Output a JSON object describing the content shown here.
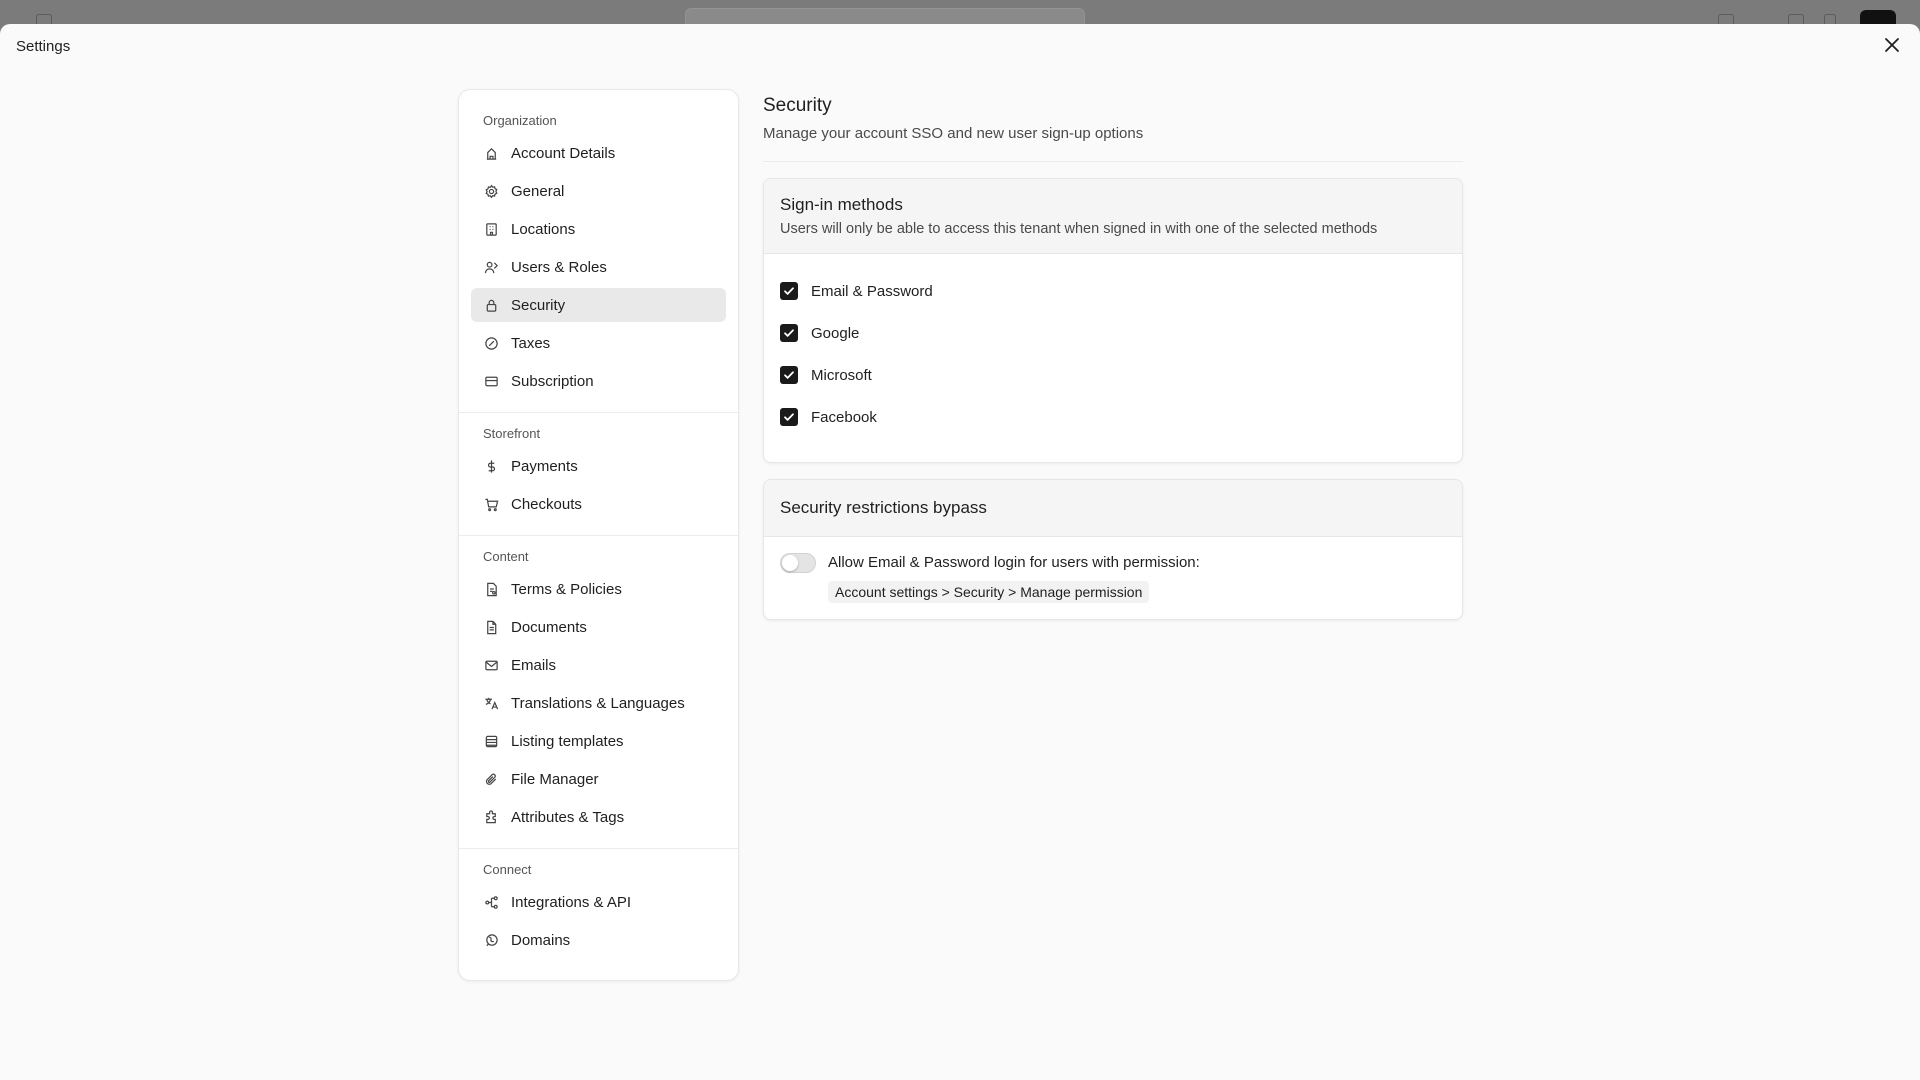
{
  "modal": {
    "title": "Settings"
  },
  "sidebar": {
    "sections": [
      {
        "title": "Organization",
        "items": [
          {
            "label": "Account Details",
            "icon": "building-icon"
          },
          {
            "label": "General",
            "icon": "gear-icon"
          },
          {
            "label": "Locations",
            "icon": "office-building-icon"
          },
          {
            "label": "Users & Roles",
            "icon": "users-icon"
          },
          {
            "label": "Security",
            "icon": "lock-icon",
            "active": true
          },
          {
            "label": "Taxes",
            "icon": "percent-badge-icon"
          },
          {
            "label": "Subscription",
            "icon": "credit-card-icon"
          }
        ]
      },
      {
        "title": "Storefront",
        "items": [
          {
            "label": "Payments",
            "icon": "dollar-icon"
          },
          {
            "label": "Checkouts",
            "icon": "cart-icon"
          }
        ]
      },
      {
        "title": "Content",
        "items": [
          {
            "label": "Terms & Policies",
            "icon": "policy-document-icon"
          },
          {
            "label": "Documents",
            "icon": "document-icon"
          },
          {
            "label": "Emails",
            "icon": "mail-icon"
          },
          {
            "label": "Translations & Languages",
            "icon": "translate-icon"
          },
          {
            "label": "Listing templates",
            "icon": "template-list-icon"
          },
          {
            "label": "File Manager",
            "icon": "paperclip-icon"
          },
          {
            "label": "Attributes & Tags",
            "icon": "puzzle-icon"
          }
        ]
      },
      {
        "title": "Connect",
        "items": [
          {
            "label": "Integrations & API",
            "icon": "integration-icon"
          },
          {
            "label": "Domains",
            "icon": "globe-icon"
          }
        ]
      }
    ]
  },
  "main": {
    "title": "Security",
    "subtitle": "Manage your account SSO and new user sign-up options",
    "signin": {
      "title": "Sign-in methods",
      "description": "Users will only be able to access this tenant when signed in with one of the selected methods",
      "methods": [
        {
          "label": "Email & Password",
          "checked": true
        },
        {
          "label": "Google",
          "checked": true
        },
        {
          "label": "Microsoft",
          "checked": true
        },
        {
          "label": "Facebook",
          "checked": true
        }
      ]
    },
    "bypass": {
      "title": "Security restrictions bypass",
      "toggle_on": false,
      "text": "Allow Email & Password login for users with permission:",
      "permission": "Account settings > Security > Manage permission"
    }
  },
  "colors": {
    "accent_dark": "#1a1a1a",
    "active_item_bg": "#e9e9e9",
    "overlay": "#7b7b7b"
  }
}
